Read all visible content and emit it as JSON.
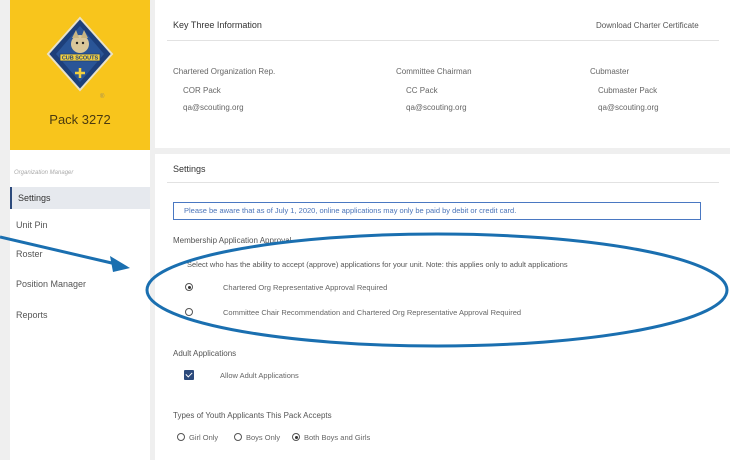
{
  "sidebar": {
    "pack_name": "Pack 3272",
    "emblem_text": "CUB SCOUTS",
    "section_label": "Organization Manager",
    "items": [
      {
        "label": "Settings",
        "active": true
      },
      {
        "label": "Unit Pin",
        "active": false
      },
      {
        "label": "Roster",
        "active": false
      },
      {
        "label": "Position Manager",
        "active": false
      },
      {
        "label": "Reports",
        "active": false
      }
    ]
  },
  "key_three": {
    "title": "Key Three Information",
    "download_link": "Download Charter Certificate",
    "columns": [
      {
        "role": "Chartered Organization Rep.",
        "name": "COR Pack",
        "email": "qa@scouting.org"
      },
      {
        "role": "Committee Chairman",
        "name": "CC Pack",
        "email": "qa@scouting.org"
      },
      {
        "role": "Cubmaster",
        "name": "Cubmaster Pack",
        "email": "qa@scouting.org"
      }
    ]
  },
  "settings": {
    "title": "Settings",
    "notice": "Please be aware that as of July 1, 2020, online applications may only be paid by debit or credit card.",
    "membership_heading": "Membership Application Approval",
    "membership_desc": "Select who has the ability to accept (approve) applications for your unit. Note: this applies only to adult applications",
    "approval_options": [
      {
        "label": "Chartered Org Representative Approval Required",
        "selected": true
      },
      {
        "label": "Committee Chair Recommendation and Chartered Org Representative Approval Required",
        "selected": false
      }
    ],
    "adult_heading": "Adult Applications",
    "adult_checkbox_label": "Allow Adult Applications",
    "adult_checked": true,
    "youth_heading": "Types of Youth Applicants This Pack Accepts",
    "youth_options": [
      {
        "label": "Girl Only",
        "selected": false
      },
      {
        "label": "Boys Only",
        "selected": false
      },
      {
        "label": "Both Boys and Girls",
        "selected": true
      }
    ]
  },
  "colors": {
    "logo_bg": "#f8c51c",
    "accent_blue": "#2c4a7c",
    "annotation_blue": "#1a6fb0",
    "notice_text": "#4b74b8"
  }
}
